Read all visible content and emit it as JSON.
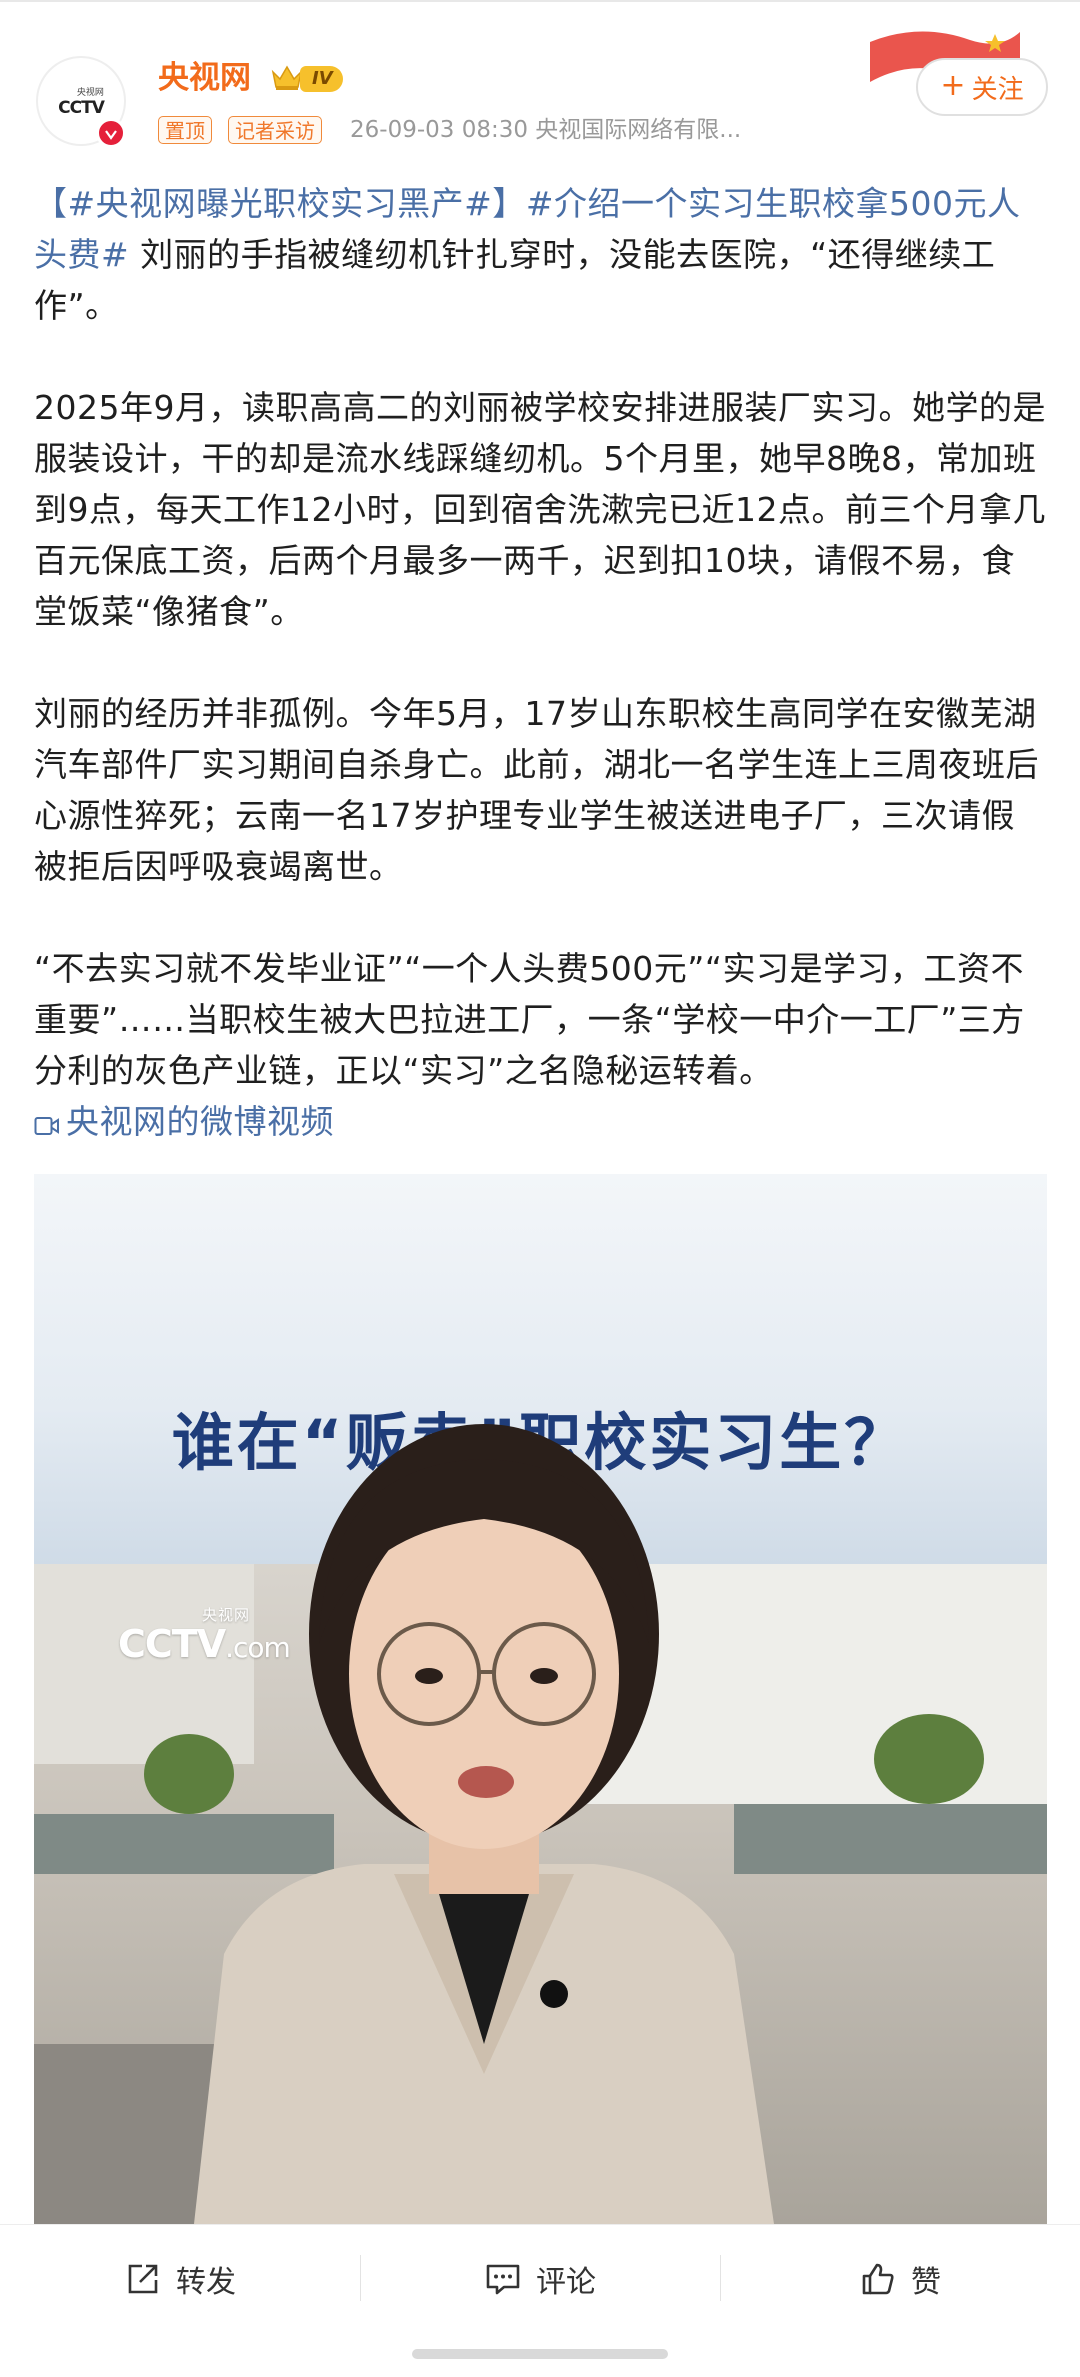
{
  "post": {
    "author": {
      "name": "央视网",
      "level": "IV",
      "avatar_logo": "CCTV",
      "avatar_logo_cn": "央视网"
    },
    "tags": [
      "置顶",
      "记者采访"
    ],
    "meta": "26-09-03 08:30  央视国际网络有限...",
    "follow_label": "关注",
    "paragraph1": {
      "hashtag1": "【#央视网曝光职校实习黑产#】",
      "hashtag2": "#介绍一个实习生职校拿500元人头费#",
      "text": " 刘丽的手指被缝纫机针扎穿时，没能去医院，“还得继续工作”。"
    },
    "paragraph2": "2025年9月，读职高高二的刘丽被学校安排进服装厂实习。她学的是服装设计，干的却是流水线踩缝纫机。5个月里，她早8晚8，常加班到9点，每天工作12小时，回到宿舍洗漱完已近12点。前三个月拿几百元保底工资，后两个月最多一两千，迟到扣10块，请假不易，食堂饭菜“像猪食”。",
    "paragraph3": "刘丽的经历并非孤例。今年5月，17岁山东职校生高同学在安徽芜湖汽车部件厂实习期间自杀身亡。此前，湖北一名学生连上三周夜班后心源性猝死；云南一名17岁护理专业学生被送进电子厂，三次请假被拒后因呼吸衰竭离世。",
    "paragraph4": {
      "text": "“不去实习就不发毕业证”“一个人头费500元”“实习是学习，工资不重要”……当职校生被大巴拉进工厂，一条“学校一中介一工厂”三方分利的灰色产业链，正以“实习”之名隐秘运转着。",
      "video_link": "央视网的微博视频"
    },
    "media": {
      "title": "谁在“贩卖”职校实习生？",
      "watermark_cn": "央视网",
      "watermark_main": "CCTV",
      "watermark_com": ".com"
    }
  },
  "actions": {
    "repost": "转发",
    "comment": "评论",
    "like": "赞"
  },
  "colors": {
    "author_orange": "#f26b1b",
    "hashtag_blue": "#4a6fa6",
    "verified_red": "#e5203a",
    "media_title_blue": "#1f3d7a"
  },
  "icons": [
    "crown-icon",
    "verified-icon",
    "plus-icon",
    "video-link-icon",
    "repost-icon",
    "comment-icon",
    "like-icon"
  ]
}
